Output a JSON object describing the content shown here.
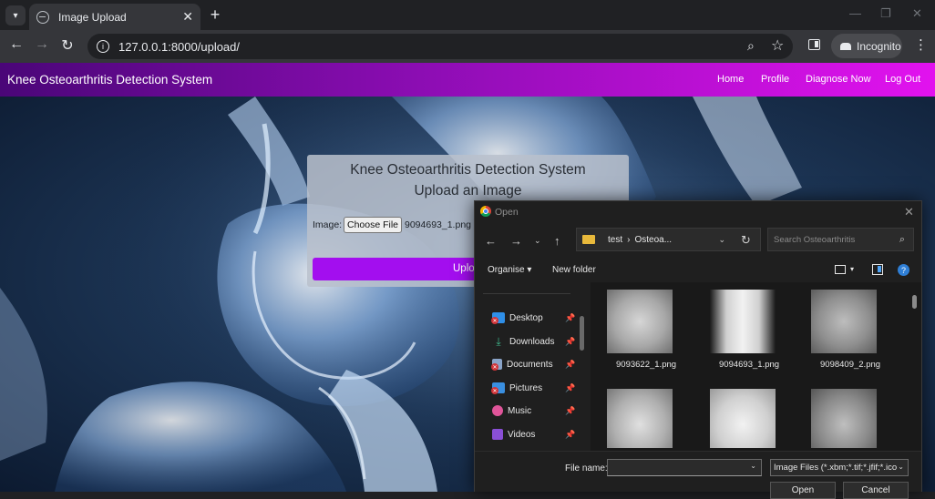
{
  "browser": {
    "tab_title": "Image Upload",
    "tab_close": "✕",
    "new_tab": "+",
    "url": "127.0.0.1:8000/upload/",
    "incognito_label": "Incognito"
  },
  "site": {
    "brand": "Knee Osteoarthritis Detection System",
    "nav": [
      "Home",
      "Profile",
      "Diagnose Now",
      "Log Out"
    ]
  },
  "upload_form": {
    "title": "Knee Osteoarthritis Detection System",
    "subtitle": "Upload an Image",
    "image_label": "Image:",
    "choose_file_label": "Choose File",
    "selected_file": "9094693_1.png",
    "upload_button": "Uplo"
  },
  "dialog": {
    "title": "Open",
    "path": [
      "test",
      "›",
      "Osteoa..."
    ],
    "search_placeholder": "Search Osteoarthritis",
    "organise_label": "Organise ▾",
    "new_folder_label": "New folder",
    "quick_access": [
      {
        "label": "Desktop",
        "icon": "desktop-icon",
        "color": "#2f8fe8",
        "error": true
      },
      {
        "label": "Downloads",
        "icon": "download-icon",
        "color": "#3fb68b",
        "error": false
      },
      {
        "label": "Documents",
        "icon": "documents-icon",
        "color": "#8aa4c8",
        "error": true
      },
      {
        "label": "Pictures",
        "icon": "pictures-icon",
        "color": "#3a8fe0",
        "error": true
      },
      {
        "label": "Music",
        "icon": "music-icon",
        "color": "#e0559a",
        "error": false
      },
      {
        "label": "Videos",
        "icon": "videos-icon",
        "color": "#8a4fd6",
        "error": false
      }
    ],
    "files": [
      {
        "name": "9093622_1.png"
      },
      {
        "name": "9094693_1.png"
      },
      {
        "name": "9098409_2.png"
      },
      {
        "name": ""
      },
      {
        "name": ""
      },
      {
        "name": ""
      }
    ],
    "file_name_label": "File name:",
    "file_name_value": "",
    "file_type_filter": "Image Files (*.xbm;*.tif;*.jfif;*.ico",
    "open_button": "Open",
    "cancel_button": "Cancel"
  }
}
